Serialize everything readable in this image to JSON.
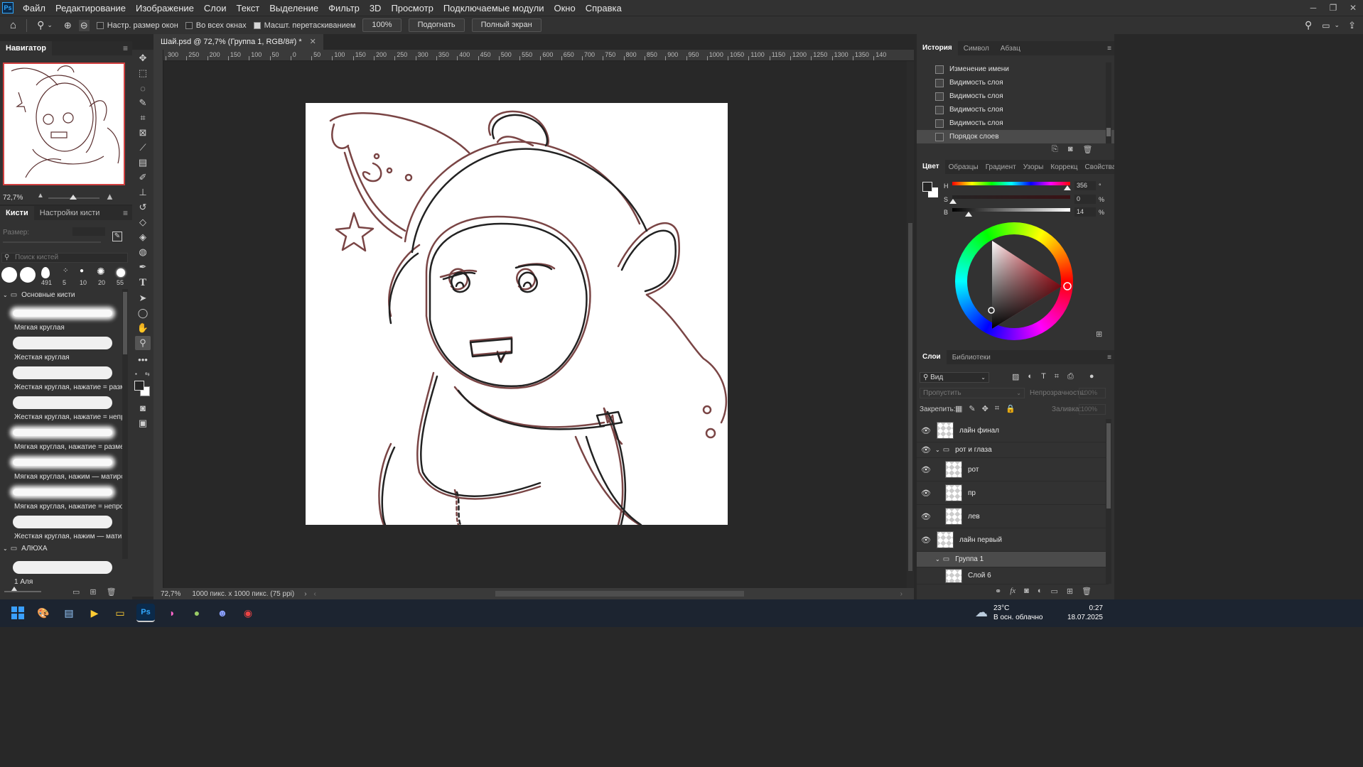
{
  "menubar": {
    "logo": "Ps",
    "items": [
      "Файл",
      "Редактирование",
      "Изображение",
      "Слои",
      "Текст",
      "Выделение",
      "Фильтр",
      "3D",
      "Просмотр",
      "Подключаемые модули",
      "Окно",
      "Справка"
    ]
  },
  "options": {
    "resize_windows": "Настр. размер окон",
    "all_windows": "Во всех окнах",
    "scrubby_zoom": "Масшт. перетаскиванием",
    "zoom_value": "100%",
    "fit": "Подогнать",
    "fullscreen": "Полный экран"
  },
  "navigator": {
    "title": "Навигатор",
    "zoom": "72,7%"
  },
  "brushes": {
    "tab1": "Кисти",
    "tab2": "Настройки кисти",
    "size_label": "Размер:",
    "search_placeholder": "Поиск кистей",
    "presets": [
      "",
      "",
      "491",
      "5",
      "10",
      "20",
      "55"
    ],
    "group1": "Основные кисти",
    "items": [
      "Мягкая круглая",
      "Жесткая круглая",
      "Жесткая круглая, нажатие = размер",
      "Жесткая круглая, нажатие = непр...",
      "Мягкая круглая, нажатие = размер",
      "Мягкая круглая, нажим — матиров...",
      "Мягкая круглая, нажатие = непроз...",
      "Жесткая круглая, нажим — матиро..."
    ],
    "group2": "АЛЮХА",
    "item2": "1 Аля"
  },
  "document": {
    "tab": "Шай.psd @ 72,7% (Группа 1, RGB/8#) *",
    "ruler_labels": [
      "300",
      "250",
      "200",
      "150",
      "100",
      "50",
      "0",
      "50",
      "100",
      "150",
      "200",
      "250",
      "300",
      "350",
      "400",
      "450",
      "500",
      "550",
      "600",
      "650",
      "700",
      "750",
      "800",
      "850",
      "900",
      "950",
      "1000",
      "1050",
      "1100",
      "1150",
      "1200",
      "1250",
      "1300",
      "1350",
      "140"
    ],
    "status_zoom": "72,7%",
    "status_info": "1000 пикс. x 1000 пикс. (75 ppi)"
  },
  "history": {
    "tabs": [
      "История",
      "Символ",
      "Абзац"
    ],
    "items": [
      "Изменение имени",
      "Видимость слоя",
      "Видимость слоя",
      "Видимость слоя",
      "Видимость слоя",
      "Порядок слоев"
    ]
  },
  "color": {
    "tabs": [
      "Цвет",
      "Образцы",
      "Градиент",
      "Узоры",
      "Коррекц",
      "Свойства"
    ],
    "h_label": "H",
    "h_value": "356",
    "h_unit": "°",
    "s_label": "S",
    "s_value": "0",
    "s_unit": "%",
    "b_label": "B",
    "b_value": "14",
    "b_unit": "%"
  },
  "layers": {
    "tabs": [
      "Слои",
      "Библиотеки"
    ],
    "filter": "Вид",
    "blend": "Пропустить",
    "opacity_label": "Непрозрачность:",
    "opacity_value": "100%",
    "lock_label": "Закрепить:",
    "fill_label": "Заливка:",
    "fill_value": "100%",
    "items": [
      "лайн финал",
      "рот и глаза",
      "рот",
      "пр",
      "лев",
      "лайн первый",
      "Группа 1",
      "Слой 6"
    ]
  },
  "taskbar": {
    "temp": "23°C",
    "weather": "В осн. облачно",
    "time": "0:27",
    "date": "18.07.2025"
  }
}
